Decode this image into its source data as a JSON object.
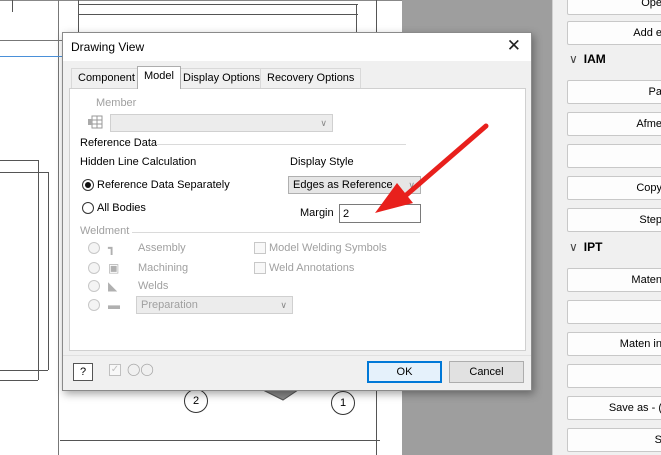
{
  "right_panel": {
    "buttons_top": [
      "Ope",
      "Add e"
    ],
    "section_iam": "IAM",
    "buttons_iam": [
      "Pa",
      "Afme",
      "",
      "Copy",
      "Step"
    ],
    "section_ipt": "IPT",
    "buttons_ipt": [
      "Maten",
      "",
      "Maten in",
      "",
      "Save as - (",
      "S"
    ]
  },
  "drawing": {
    "balloons": [
      "2",
      "1"
    ]
  },
  "dialog": {
    "title": "Drawing View",
    "tabs": [
      "Component",
      "Model",
      "Display Options",
      "Recovery Options"
    ],
    "active_tab": "Model",
    "member_label": "Member",
    "reference_data_label": "Reference Data",
    "hidden_line_label": "Hidden Line Calculation",
    "radio_ref_separately": "Reference Data Separately",
    "radio_all_bodies": "All Bodies",
    "display_style_label": "Display Style",
    "display_style_value": "Edges as Reference",
    "margin_label": "Margin",
    "margin_value": "2",
    "weldment_label": "Weldment",
    "weld_options": [
      "Assembly",
      "Machining",
      "Welds",
      "Preparation"
    ],
    "check_model_welding": "Model Welding Symbols",
    "check_weld_annotations": "Weld Annotations",
    "ok_label": "OK",
    "cancel_label": "Cancel"
  },
  "annotation": {
    "arrow_color": "#e8201c"
  }
}
